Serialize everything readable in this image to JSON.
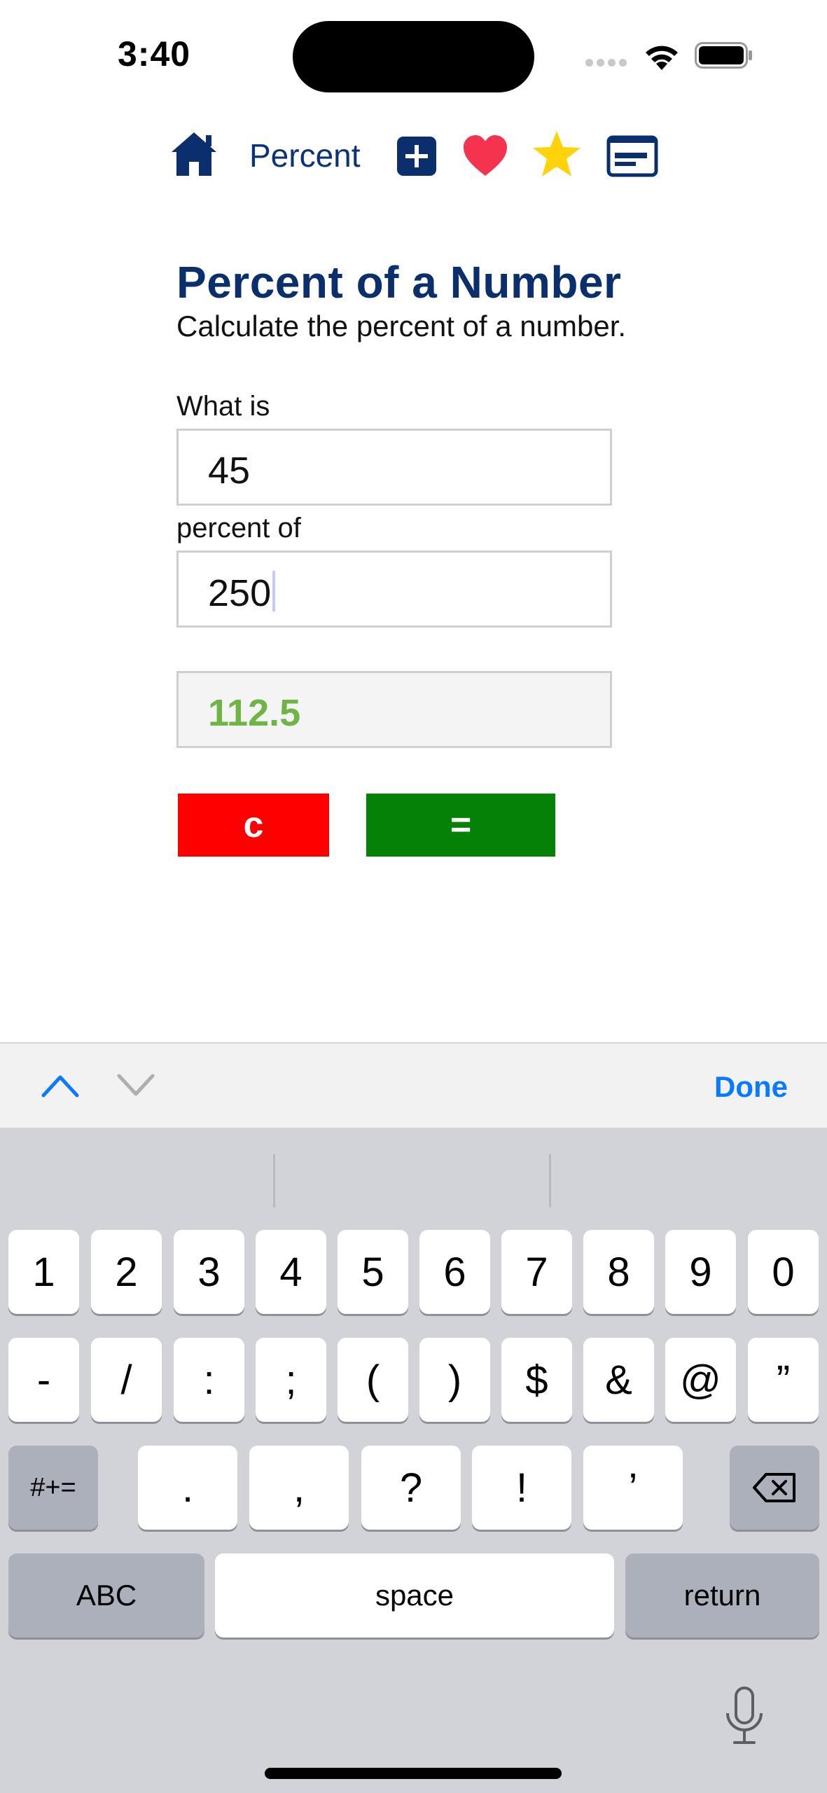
{
  "status_bar": {
    "time": "3:40"
  },
  "nav": {
    "percent_label": "Percent"
  },
  "page": {
    "title": "Percent of a Number",
    "subtitle": "Calculate the percent of a number."
  },
  "form": {
    "label_what_is": "What is",
    "value_what_is": "45",
    "label_percent_of": "percent of",
    "value_percent_of": "250",
    "result": "112.5",
    "clear_label": "c",
    "equals_label": "="
  },
  "colors": {
    "title": "#0b2f6c",
    "result_text": "#6fb444",
    "clear_button": "#ff0000",
    "equals_button": "#058205",
    "done": "#0a7aff"
  },
  "accessory": {
    "done_label": "Done"
  },
  "keyboard": {
    "row1": [
      "1",
      "2",
      "3",
      "4",
      "5",
      "6",
      "7",
      "8",
      "9",
      "0"
    ],
    "row2": [
      "-",
      "/",
      ":",
      ";",
      "(",
      ")",
      "$",
      "&",
      "@",
      "”"
    ],
    "row3_left": "#+=",
    "row3": [
      ".",
      ",",
      "?",
      "!",
      "’"
    ],
    "row4_left": "ABC",
    "row4_space": "space",
    "row4_return": "return"
  }
}
